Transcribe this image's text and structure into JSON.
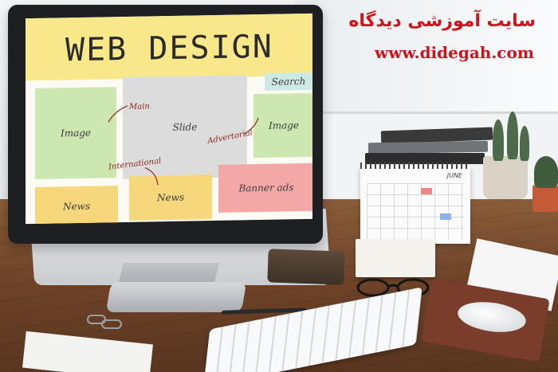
{
  "watermark": {
    "persian_title": "سایت آموزشی دیدگاه",
    "url": "www.didegah.com",
    "color": "#d0121a"
  },
  "screen": {
    "heading": "WEB DESIGN",
    "boxes": {
      "image_left": "Image",
      "slide": "Slide",
      "search": "Search",
      "image_right": "Image",
      "news_left": "News",
      "news_middle": "News",
      "banner": "Banner ads"
    },
    "annotations": {
      "main": "Main",
      "advertorial": "Advertorial",
      "international": "International"
    }
  },
  "calendar": {
    "month": "JUNE"
  }
}
